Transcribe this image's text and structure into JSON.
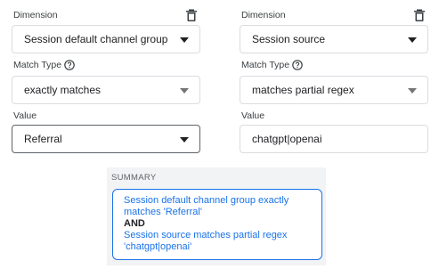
{
  "left": {
    "dimension_label": "Dimension",
    "dimension_value": "Session default channel group",
    "match_type_label": "Match Type",
    "match_type_value": "exactly matches",
    "value_label": "Value",
    "value_value": "Referral"
  },
  "right": {
    "dimension_label": "Dimension",
    "dimension_value": "Session source",
    "match_type_label": "Match Type",
    "match_type_value": "matches partial regex",
    "value_label": "Value",
    "value_value": "chatgpt|openai"
  },
  "summary": {
    "label": "SUMMARY",
    "line1": "Session default channel group exactly matches 'Referral'",
    "conjunction": "AND",
    "line2": "Session source matches partial regex 'chatgpt|openai'"
  },
  "icons": {
    "delete": "trash-icon",
    "help": "help-circle-icon",
    "dropdown": "caret-down-icon"
  },
  "colors": {
    "accent": "#1a73e8",
    "border": "#dadce0",
    "summary_bg": "#f1f3f4"
  }
}
